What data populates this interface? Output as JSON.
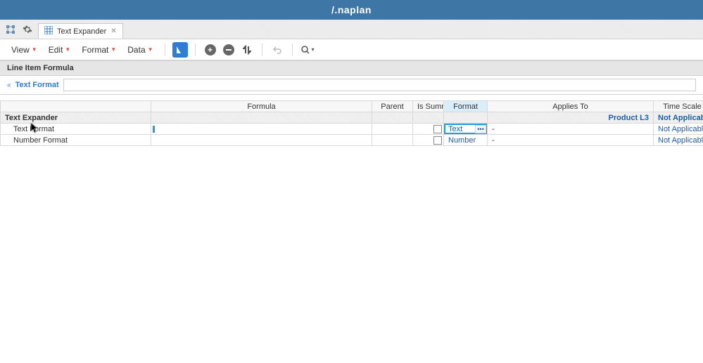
{
  "app": {
    "logo_text": "/.naplan"
  },
  "tab": {
    "title": "Text Expander"
  },
  "menu": {
    "view": "View",
    "edit": "Edit",
    "format": "Format",
    "data": "Data"
  },
  "section": {
    "title": "Line Item Formula"
  },
  "filter": {
    "label": "Text Format",
    "value": ""
  },
  "columns": {
    "formula": "Formula",
    "parent": "Parent",
    "is_summary": "Is Summary",
    "format": "Format",
    "applies_to": "Applies To",
    "time_scale": "Time Scale"
  },
  "module": {
    "name": "Text Expander",
    "applies_to": "Product L3",
    "time_scale": "Not Applicable"
  },
  "rows": [
    {
      "name": "Text Format",
      "formula": "",
      "parent": "",
      "is_summary": false,
      "format": "Text",
      "applies_to": "-",
      "time_scale": "Not Applicable",
      "format_active": true,
      "cursor": true
    },
    {
      "name": "Number Format",
      "formula": "",
      "parent": "",
      "is_summary": false,
      "format": "Number",
      "applies_to": "-",
      "time_scale": "Not Applicable",
      "format_active": false,
      "cursor": false
    }
  ]
}
